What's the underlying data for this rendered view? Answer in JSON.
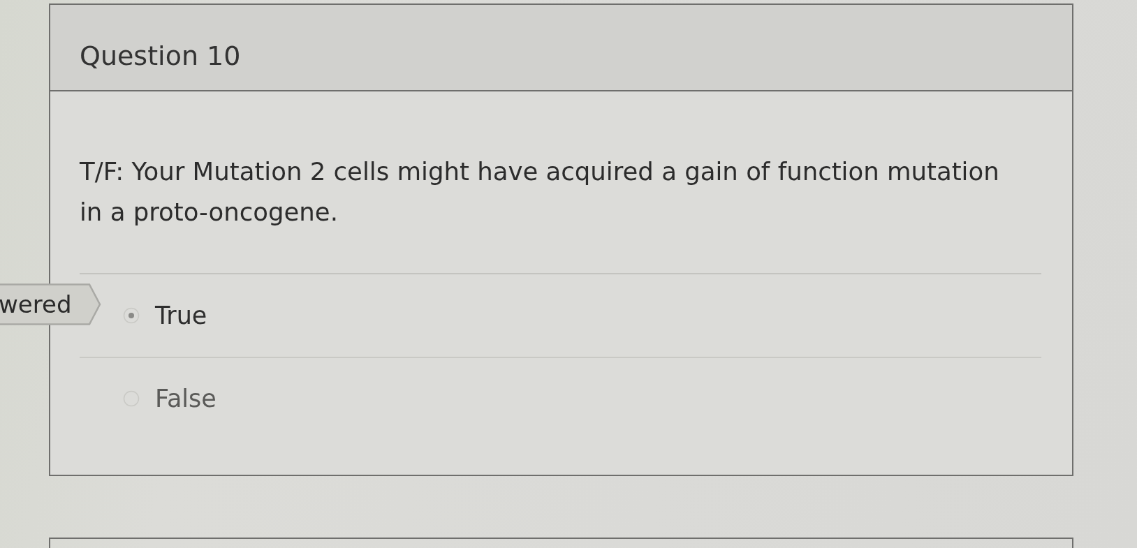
{
  "question": {
    "title": "Question 10",
    "text": "T/F: Your Mutation 2 cells might have acquired a gain of function mutation in a proto-oncogene."
  },
  "status_tag": {
    "label": "wered"
  },
  "answers": [
    {
      "label": "True",
      "selected": true
    },
    {
      "label": "False",
      "selected": false
    }
  ]
}
